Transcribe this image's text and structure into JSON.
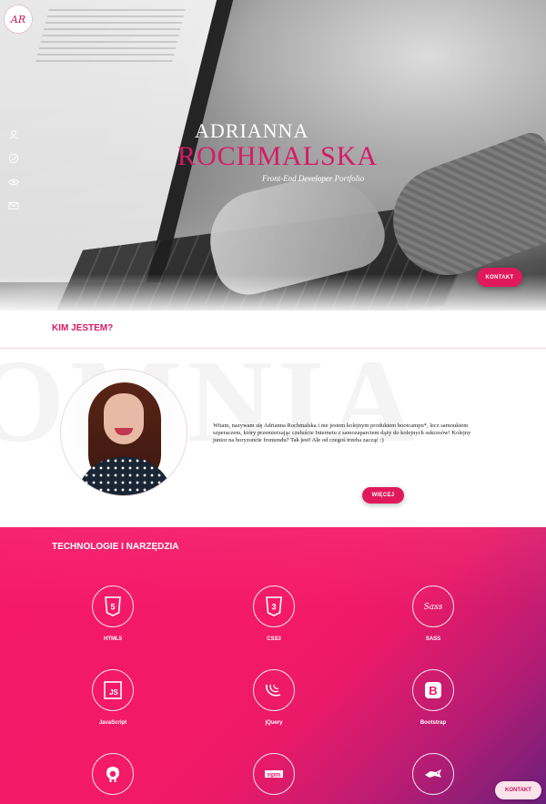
{
  "hero": {
    "logo_text": "AR",
    "first_name": "ADRIANNA",
    "last_name": "ROCHMALSKA",
    "subtitle": "Front-End Developer Portfolio",
    "contact_button": "KONTAKT",
    "nav_icons": [
      "user-icon",
      "check-circle-icon",
      "eye-icon",
      "envelope-icon"
    ]
  },
  "about": {
    "title": "KIM JESTEM?",
    "watermark": "OMNIA",
    "text": "Witam, nazywam się Adrianna Rochmalska i nie jestem kolejnym produktem bootcampu*, lecz samoukiem szperaczem, który przemierzając czeluście Internetu z samozaparciem dąży do kolejnych sukcesów! Kolejny junior na horyzoncie frontendu? Tak jest! Ale od czegoś trzeba zacząć :)",
    "more_button": "WIĘCEJ"
  },
  "tech": {
    "title": "TECHNOLOGIE I NARZĘDZIA",
    "items": [
      {
        "label": "HTML5",
        "icon": "html5-icon"
      },
      {
        "label": "CSS3",
        "icon": "css3-icon"
      },
      {
        "label": "SASS",
        "icon": "sass-icon"
      },
      {
        "label": "JavaScript",
        "icon": "javascript-icon"
      },
      {
        "label": "jQuery",
        "icon": "jquery-icon"
      },
      {
        "label": "Bootstrap",
        "icon": "bootstrap-icon"
      },
      {
        "label": "",
        "icon": "github-icon"
      },
      {
        "label": "",
        "icon": "npm-icon"
      },
      {
        "label": "",
        "icon": "gulp-icon"
      }
    ],
    "icon_text": {
      "html": "5",
      "css": "3",
      "sass": "Sass",
      "js": "JS",
      "bootstrap": "B",
      "npm": "npm"
    }
  },
  "floating_contact": "KONTAKT",
  "colors": {
    "accent": "#e0195d",
    "gradient_start": "#f5176a",
    "gradient_end": "#6a1f7a"
  }
}
